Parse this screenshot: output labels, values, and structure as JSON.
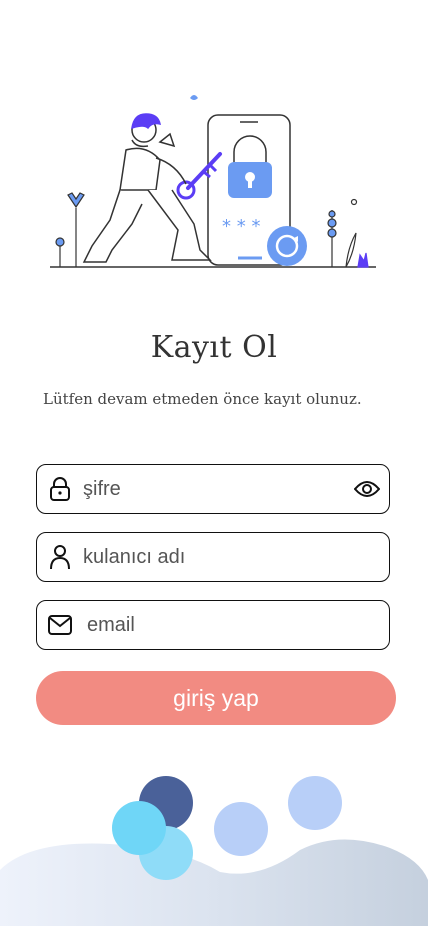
{
  "header": {
    "title": "Kayıt Ol",
    "subtitle": "Lütfen devam etmeden önce kayıt  olunuz."
  },
  "form": {
    "password": {
      "placeholder": "şifre",
      "icon": "lock-icon",
      "toggle_icon": "eye-icon"
    },
    "username": {
      "placeholder": "kulanıcı adı",
      "icon": "user-icon"
    },
    "email": {
      "placeholder": "email",
      "icon": "mail-icon"
    },
    "submit_label": "giriş yap"
  },
  "colors": {
    "primary_button": "#f28b82",
    "illustration_accent": "#5b3df5",
    "illustration_blue": "#6b9bf2",
    "circle_dark": "#4a6199",
    "circle_cyan": "#6fd6f7",
    "circle_light": "#b8cff8",
    "wave": "#c9d3e2"
  },
  "illustration": {
    "asterisks": "* * *"
  }
}
